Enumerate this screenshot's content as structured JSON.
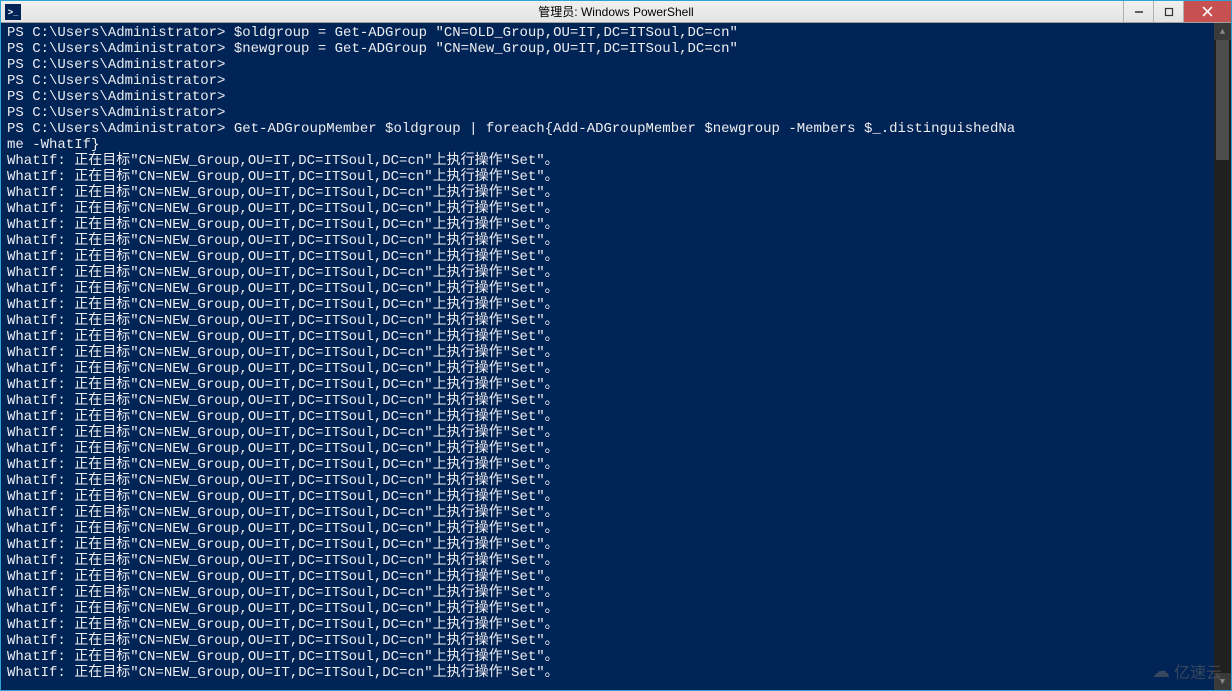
{
  "window": {
    "title": "管理员: Windows PowerShell",
    "icon_label": ">_"
  },
  "controls": {
    "minimize": "─",
    "maximize": "❐",
    "close": "✕"
  },
  "terminal": {
    "prompt": "PS C:\\Users\\Administrator>",
    "lines": [
      "PS C:\\Users\\Administrator> $oldgroup = Get-ADGroup \"CN=OLD_Group,OU=IT,DC=ITSoul,DC=cn\"",
      "PS C:\\Users\\Administrator> $newgroup = Get-ADGroup \"CN=New_Group,OU=IT,DC=ITSoul,DC=cn\"",
      "PS C:\\Users\\Administrator>",
      "PS C:\\Users\\Administrator>",
      "PS C:\\Users\\Administrator>",
      "PS C:\\Users\\Administrator>",
      "PS C:\\Users\\Administrator> Get-ADGroupMember $oldgroup | foreach{Add-ADGroupMember $newgroup -Members $_.distinguishedNa",
      "me -WhatIf}"
    ],
    "whatif_line": "WhatIf: 正在目标\"CN=NEW_Group,OU=IT,DC=ITSoul,DC=cn\"上执行操作\"Set\"。",
    "whatif_repeat_count": 33
  },
  "scrollbar": {
    "up": "▲",
    "down": "▼"
  },
  "watermark": {
    "cloud": "☁",
    "text": "亿速云"
  }
}
